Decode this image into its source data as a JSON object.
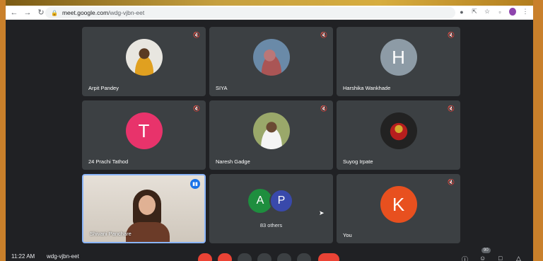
{
  "browser": {
    "url_host": "meet.google.com",
    "url_path": "/wdg-vjbn-eet"
  },
  "participants": [
    {
      "name": "Arpit Pandey"
    },
    {
      "name": "SIYA"
    },
    {
      "name": "Harshika Wankhade",
      "initial": "H",
      "color": "#8d9ba6"
    },
    {
      "name": "24 Prachi Tathod",
      "initial": "T",
      "color": "#e8336b"
    },
    {
      "name": "Naresh Gadge"
    },
    {
      "name": "Suyog Irpate"
    },
    {
      "name": "Shivani Panchare"
    },
    {
      "name": "You",
      "initial": "K",
      "color": "#e8501f"
    }
  ],
  "others": {
    "initial_a": "A",
    "initial_b": "P",
    "label": "83 others"
  },
  "bottom_bar": {
    "time": "11:22 AM",
    "meeting_code": "wdg-vjbn-eet",
    "people_count": "90"
  }
}
